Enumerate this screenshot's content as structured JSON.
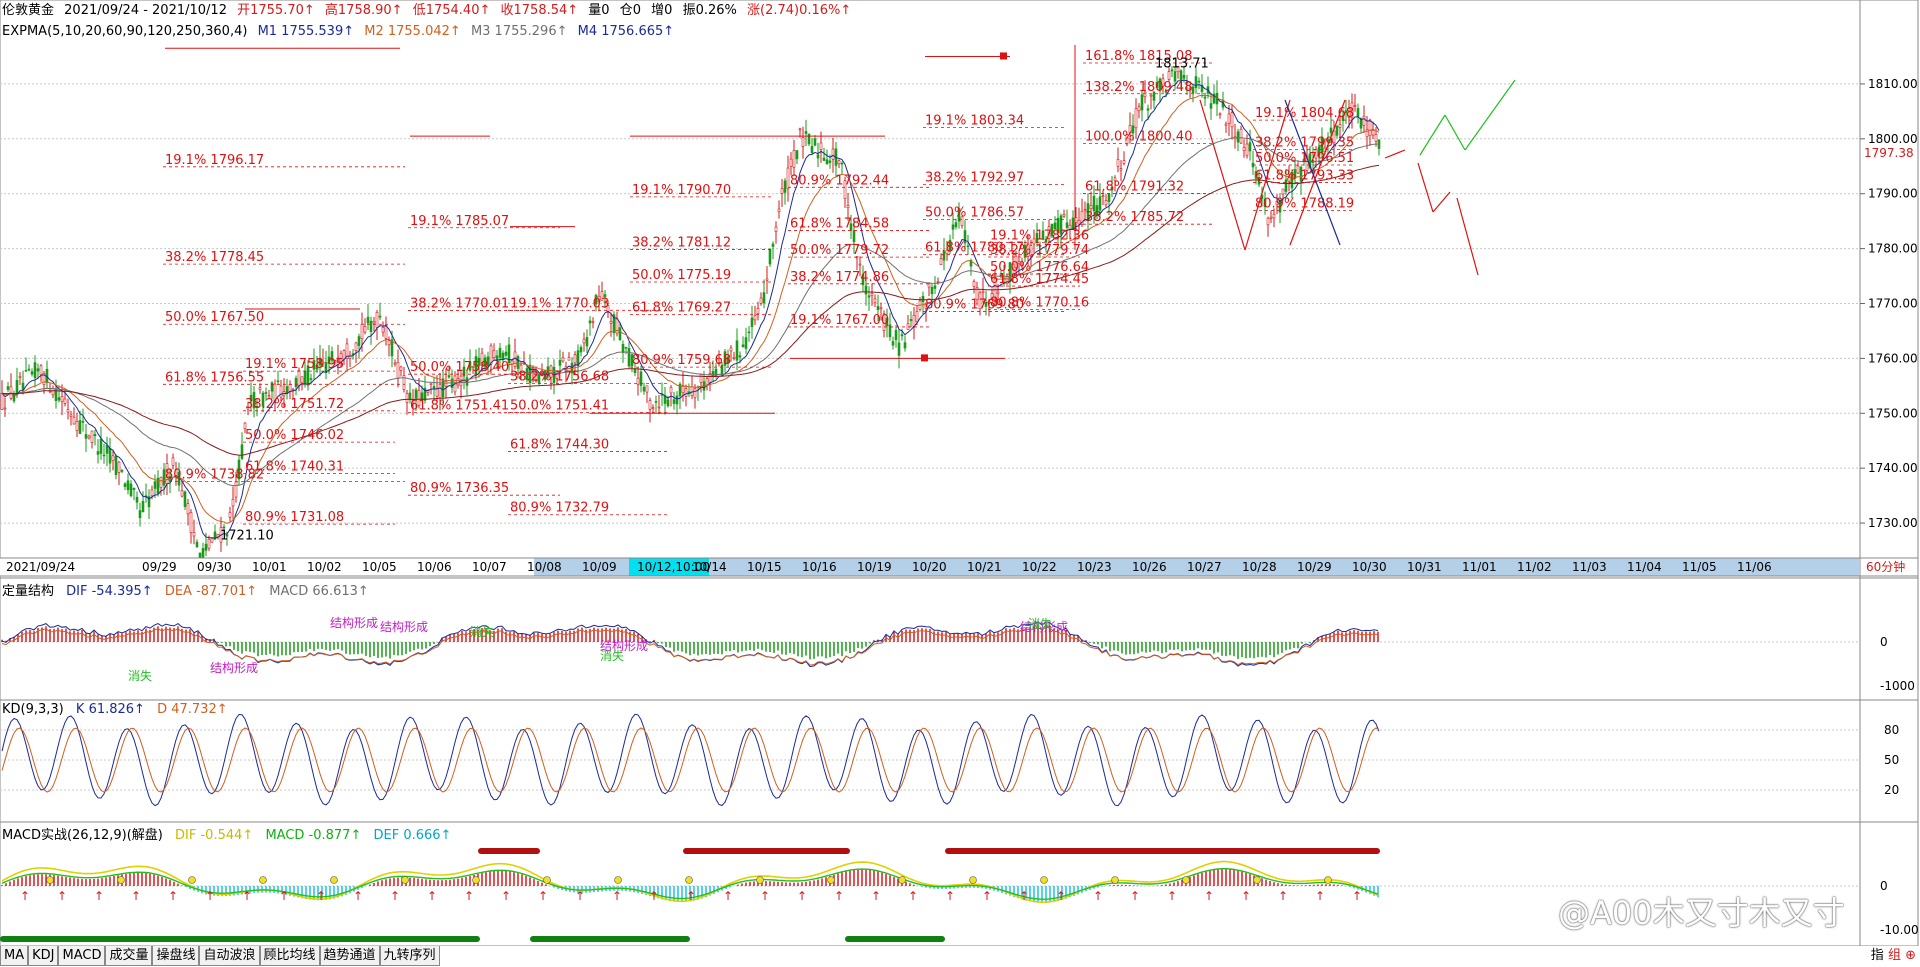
{
  "header": {
    "symbol": "伦敦黄金",
    "range": "2021/09/24 - 2021/10/12",
    "open": "开1755.70↑",
    "high": "高1758.90↑",
    "low": "低1754.40↑",
    "close": "收1758.54↑",
    "volume": "量0",
    "oi": "仓0",
    "inc": "增0",
    "amp": "振0.26%",
    "change": "涨(2.74)0.16%↑"
  },
  "expma": {
    "label": "EXPMA(5,10,20,60,90,120,250,360,4)",
    "m1": "M1 1755.539↑",
    "m2": "M2 1755.042↑",
    "m3": "M3 1755.296↑",
    "m4": "M4 1756.665↑"
  },
  "price_axis": [
    "1810.00",
    "1800.00",
    "1790.00",
    "1780.00",
    "1770.00",
    "1760.00",
    "1750.00",
    "1740.00",
    "1730.00"
  ],
  "current_price": "1797.38",
  "time_axis": {
    "start": "2021/09/24",
    "labels": [
      "09/29",
      "09/30",
      "10/01",
      "10/02",
      "10/05",
      "10/06",
      "10/07",
      "10/08",
      "10/09",
      "10/12,10:00",
      "10/14",
      "10/15",
      "10/16",
      "10/19",
      "10/20",
      "10/21",
      "10/22",
      "10/23",
      "10/26",
      "10/27",
      "10/28",
      "10/29",
      "10/30",
      "10/31",
      "11/01",
      "11/02",
      "11/03",
      "11/04",
      "11/05",
      "11/06"
    ],
    "period": "60分钟"
  },
  "fib_labels": [
    {
      "text": "19.1% 1796.17",
      "x": 1796.17,
      "col": 0
    },
    {
      "text": "38.2% 1778.45",
      "x": 1778.45,
      "col": 0
    },
    {
      "text": "50.0% 1767.50",
      "x": 1767.5,
      "col": 0
    },
    {
      "text": "61.8% 1756.55",
      "x": 1756.55,
      "col": 0
    },
    {
      "text": "80.9% 1738.82",
      "x": 1738.82,
      "col": 0
    },
    {
      "text": "19.1% 1758.95",
      "x": 1758.95,
      "col": 1
    },
    {
      "text": "38.2% 1751.72",
      "x": 1751.72,
      "col": 1
    },
    {
      "text": "50.0% 1746.02",
      "x": 1746.02,
      "col": 1
    },
    {
      "text": "61.8% 1740.31",
      "x": 1740.31,
      "col": 1
    },
    {
      "text": "80.9% 1731.08",
      "x": 1731.08,
      "col": 1
    },
    {
      "text": "19.1% 1785.07",
      "x": 1785.07,
      "col": 2
    },
    {
      "text": "38.2% 1770.01",
      "x": 1770.01,
      "col": 2
    },
    {
      "text": "50.0% 1758.40",
      "x": 1758.4,
      "col": 2
    },
    {
      "text": "61.8% 1751.41",
      "x": 1751.41,
      "col": 2
    },
    {
      "text": "80.9% 1736.35",
      "x": 1736.35,
      "col": 2
    },
    {
      "text": "19.1% 1770.03",
      "x": 1770.03,
      "col": 3
    },
    {
      "text": "38.2% 1756.68",
      "x": 1756.68,
      "col": 3
    },
    {
      "text": "50.0% 1751.41",
      "x": 1751.41,
      "col": 3
    },
    {
      "text": "61.8% 1744.30",
      "x": 1744.3,
      "col": 3
    },
    {
      "text": "80.9% 1732.79",
      "x": 1732.79,
      "col": 3
    },
    {
      "text": "19.1% 1790.70",
      "x": 1790.7,
      "col": 4
    },
    {
      "text": "38.2% 1781.12",
      "x": 1781.12,
      "col": 4
    },
    {
      "text": "50.0% 1775.19",
      "x": 1775.19,
      "col": 4
    },
    {
      "text": "61.8% 1769.27",
      "x": 1769.27,
      "col": 4
    },
    {
      "text": "80.9% 1759.68",
      "x": 1759.68,
      "col": 4
    },
    {
      "text": "80.9% 1792.44",
      "x": 1792.44,
      "col": 5
    },
    {
      "text": "61.8% 1784.58",
      "x": 1784.58,
      "col": 5
    },
    {
      "text": "50.0% 1779.72",
      "x": 1779.72,
      "col": 5
    },
    {
      "text": "38.2% 1774.86",
      "x": 1774.86,
      "col": 5
    },
    {
      "text": "19.1% 1767.00",
      "x": 1767.0,
      "col": 5
    },
    {
      "text": "19.1% 1803.34",
      "x": 1803.34,
      "col": 6
    },
    {
      "text": "38.2% 1792.97",
      "x": 1792.97,
      "col": 6
    },
    {
      "text": "50.0% 1786.57",
      "x": 1786.57,
      "col": 6
    },
    {
      "text": "61.8% 1780.17",
      "x": 1780.17,
      "col": 6
    },
    {
      "text": "80.9% 1769.80",
      "x": 1769.8,
      "col": 6
    },
    {
      "text": "19.1% 1782.36",
      "x": 1782.36,
      "col": 7
    },
    {
      "text": "38.2% 1779.74",
      "x": 1779.74,
      "col": 7
    },
    {
      "text": "50.0% 1776.64",
      "x": 1776.64,
      "col": 7
    },
    {
      "text": "61.8% 1774.45",
      "x": 1774.45,
      "col": 7
    },
    {
      "text": "80.8% 1770.16",
      "x": 1770.16,
      "col": 7
    },
    {
      "text": "161.8% 1815.08",
      "x": 1815.08,
      "col": 8
    },
    {
      "text": "138.2% 1809.48",
      "x": 1809.48,
      "col": 8
    },
    {
      "text": "100.0% 1800.40",
      "x": 1800.4,
      "col": 8
    },
    {
      "text": "61.8% 1791.32",
      "x": 1791.32,
      "col": 8
    },
    {
      "text": "38.2% 1785.72",
      "x": 1785.72,
      "col": 8
    },
    {
      "text": "19.1% 1804.68",
      "x": 1804.68,
      "col": 9
    },
    {
      "text": "38.2% 1799.35",
      "x": 1799.35,
      "col": 9
    },
    {
      "text": "50.0% 1796.51",
      "x": 1796.51,
      "col": 9
    },
    {
      "text": "61.8% 1793.33",
      "x": 1793.33,
      "col": 9
    },
    {
      "text": "80.9% 1788.19",
      "x": 1788.19,
      "col": 9
    }
  ],
  "price_marks": {
    "high": "1813.71",
    "low": "1721.10"
  },
  "panel_macd1": {
    "name": "定量结构",
    "dif": "DIF -54.395↑",
    "dea": "DEA -87.701↑",
    "macd": "MACD 66.613↑",
    "axis": [
      "0",
      "-1000"
    ],
    "annotations": [
      "结构形成",
      "结构形成",
      "结构形成",
      "结构形成",
      "结构形成",
      "消失",
      "消失",
      "消失",
      "消失"
    ]
  },
  "panel_kd": {
    "name": "KD(9,3,3)",
    "k": "K 61.826↑",
    "d": "D 47.732↑",
    "axis": [
      "80",
      "50",
      "20"
    ]
  },
  "panel_macd2": {
    "name": "MACD实战(26,12,9)(解盘)",
    "dif": "DIF -0.544↑",
    "macd": "MACD -0.877↑",
    "def": "DEF 0.666↑",
    "axis": [
      "0",
      "-10.00"
    ]
  },
  "tabs": [
    "MA",
    "KDJ",
    "MACD",
    "成交量",
    "操盘线",
    "自动波浪",
    "顾比均线",
    "趋势通道",
    "九转序列"
  ],
  "right_tools": {
    "label": "指",
    "icon1": "组",
    "icon2": "⊕"
  },
  "watermark": "@A00木又寸木又寸",
  "colors": {
    "up": "#d41a1a",
    "down": "#1a9a1a",
    "fib": "#e01010",
    "grid": "#c8c8c8",
    "axisbar": "#b4cfe8",
    "highlight": "#00e0f0"
  }
}
